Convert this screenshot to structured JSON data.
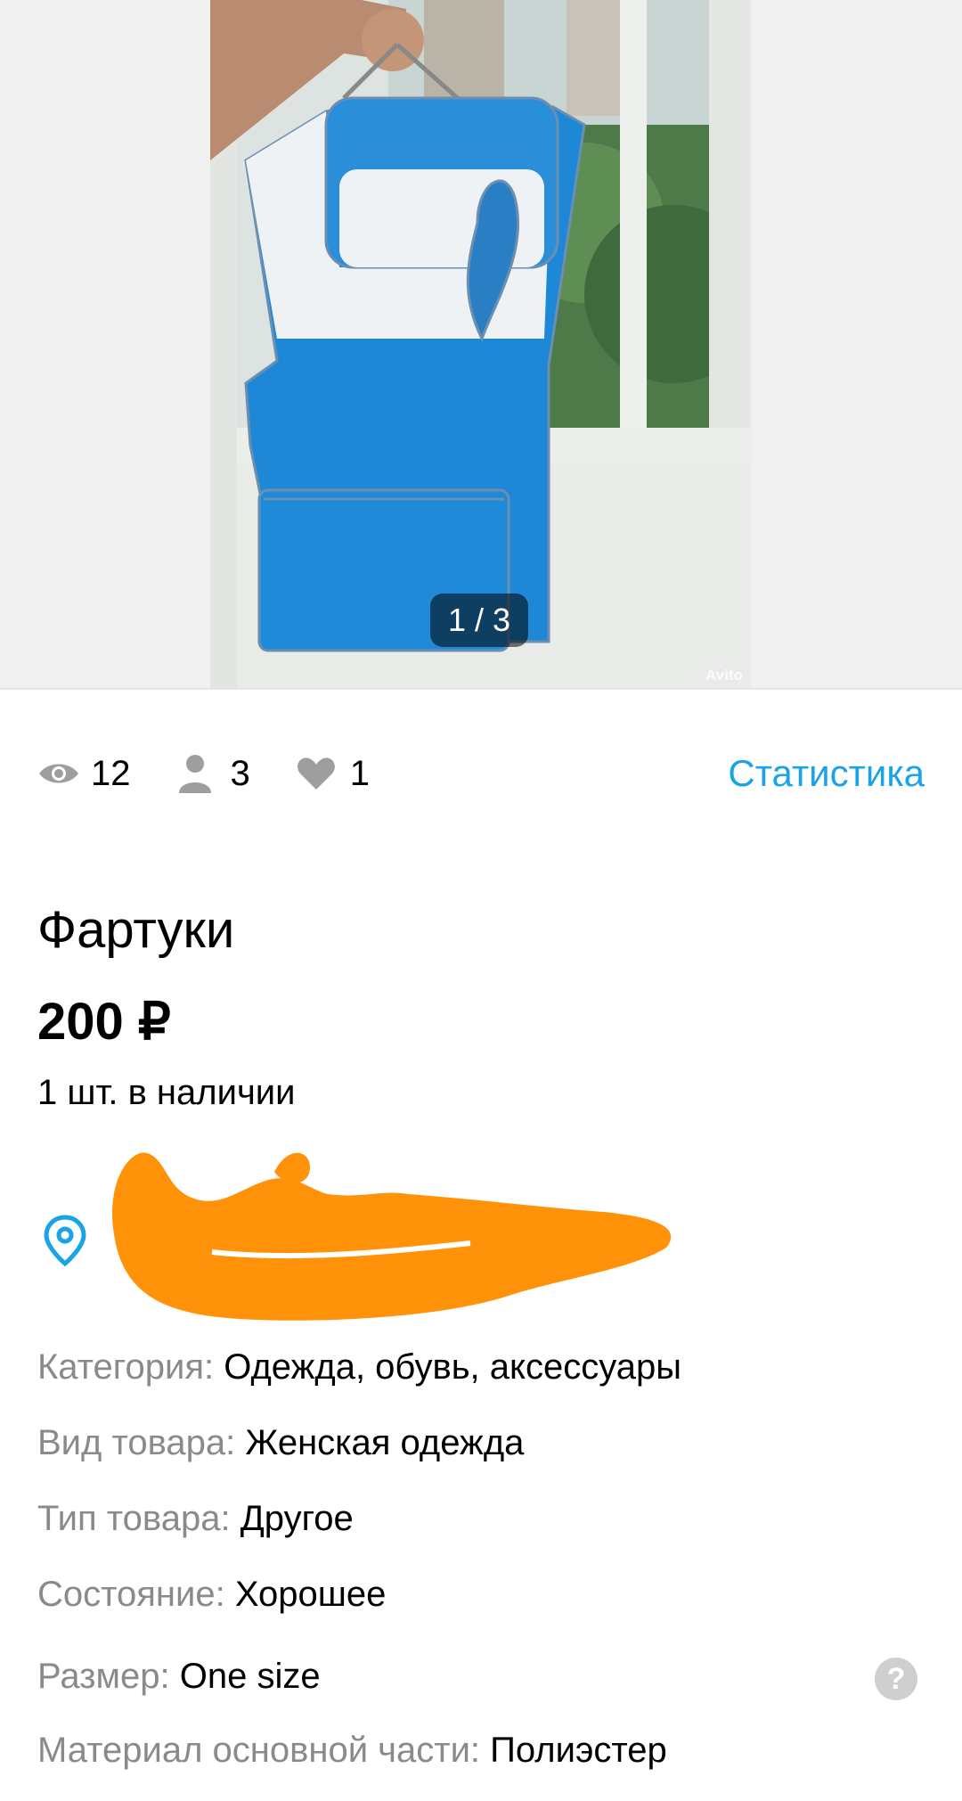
{
  "gallery": {
    "counter": "1 / 3",
    "watermark": "Avito"
  },
  "stats": {
    "views": "12",
    "contacts": "3",
    "favorites": "1",
    "link": "Статистика",
    "icons": [
      "eye-icon",
      "person-icon",
      "heart-icon"
    ]
  },
  "listing": {
    "title": "Фартуки",
    "price": "200 ₽",
    "stock": "1 шт. в наличии",
    "location_icon": "map-pin-icon"
  },
  "properties": [
    {
      "key": "Категория:",
      "value": "Одежда, обувь, аксессуары"
    },
    {
      "key": "Вид товара:",
      "value": "Женская одежда"
    },
    {
      "key": "Тип товара:",
      "value": "Другое"
    },
    {
      "key": "Состояние:",
      "value": "Хорошее"
    },
    {
      "key": "Размер:",
      "value": "One size"
    },
    {
      "key": "Материал основной части:",
      "value": "Полиэстер"
    }
  ],
  "help_label": "?",
  "colors": {
    "accent": "#1aa3e6",
    "muted_text": "#8a8a8a",
    "redaction": "#ff9208",
    "apron_blue": "#1e88d6"
  }
}
